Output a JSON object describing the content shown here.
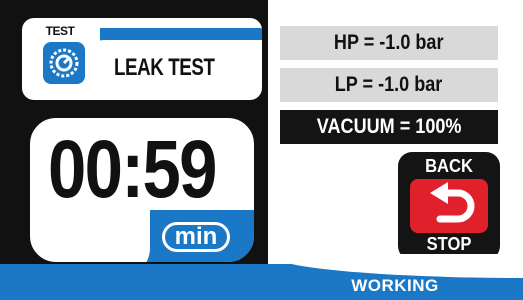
{
  "header": {
    "badge_label": "TEST",
    "title": "LEAK TEST"
  },
  "timer": {
    "value": "00:59",
    "unit": "min"
  },
  "readouts": {
    "hp": "HP = -1.0 bar",
    "lp": "LP = -1.0 bar",
    "vacuum": "VACUUM = 100%"
  },
  "controls": {
    "back_label": "BACK",
    "stop_label": "STOP"
  },
  "status": {
    "text": "WORKING"
  },
  "icons": {
    "test_icon": "gauge-dial-icon",
    "back_icon": "return-arrow-icon"
  },
  "colors": {
    "accent_blue": "#1b78c6",
    "stop_red": "#e0202a",
    "panel_dark": "#111111",
    "readout_gray": "#d9d9d9"
  }
}
